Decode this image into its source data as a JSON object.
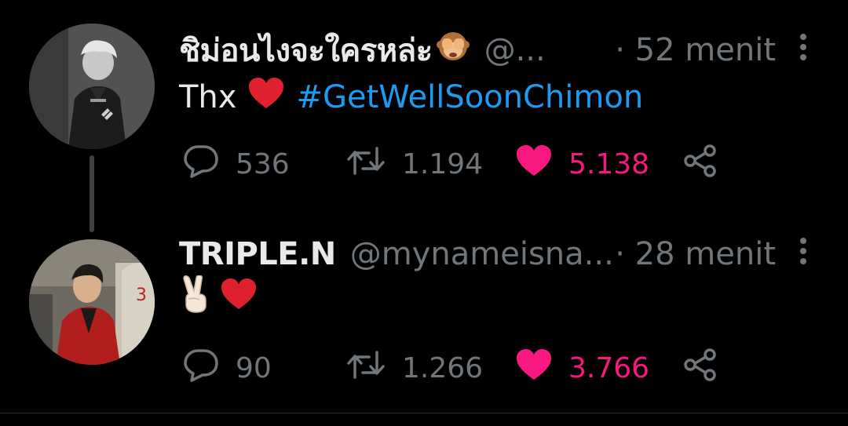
{
  "tweets": [
    {
      "display_name": "ชิม่อนไงจะใครหล่ะ",
      "name_emoji": "see-no-evil-monkey",
      "handle": "@...",
      "time": "· 52 menit",
      "text_prefix": "Thx",
      "text_emoji": "red-heart",
      "hashtag": "#GetWellSoonChimon",
      "replies": "536",
      "retweets": "1.194",
      "likes": "5.138",
      "liked": true
    },
    {
      "display_name": "TRIPLE.N",
      "handle": "@mynameisna...",
      "time": "· 28 menit",
      "text_emoji_1": "victory-hand",
      "text_emoji_2": "red-heart",
      "replies": "90",
      "retweets": "1.266",
      "likes": "3.766",
      "liked": true
    }
  ],
  "colors": {
    "background": "#000000",
    "text_primary": "#e7e9ea",
    "text_secondary": "#71767b",
    "hashtag": "#1d9bf0",
    "like": "#f91880",
    "heart_emoji": "#e0202e"
  }
}
